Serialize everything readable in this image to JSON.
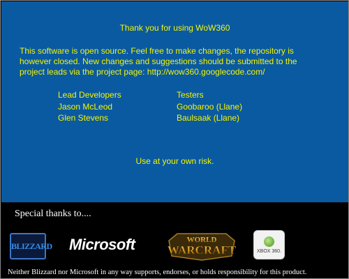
{
  "about": {
    "title": "Thank you for using WoW360",
    "paragraph_lines": [
      "This software is open source.  Feel free to make changes, the repository is",
      "however closed. New changes and suggestions should be submitted to the",
      "project leads via the project page: http://wow360.googlecode.com/"
    ],
    "lead_developers": {
      "heading": "Lead Developers",
      "names": [
        "Jason McLeod",
        "Glen Stevens"
      ]
    },
    "testers": {
      "heading": "Testers",
      "names": [
        "Goobaroo (Llane)",
        "Baulsaak (Llane)"
      ]
    },
    "risk_notice": "Use at your own risk."
  },
  "footer": {
    "special_thanks": "Special thanks to....",
    "logos": {
      "blizzard": "BLIZZARD",
      "microsoft": "Microsoft",
      "world_of_warcraft_top": "WORLD",
      "world_of_warcraft_bottom": "WARCRAFT",
      "xbox": "XBOX 360."
    },
    "disclaimer": "Neither Blizzard nor Microsoft in any way supports, endorses, or holds responsibility for this product."
  },
  "colors": {
    "panel_blue": "#0a5aa2",
    "text_yellow": "#f5f500",
    "footer_bg": "#000000"
  }
}
